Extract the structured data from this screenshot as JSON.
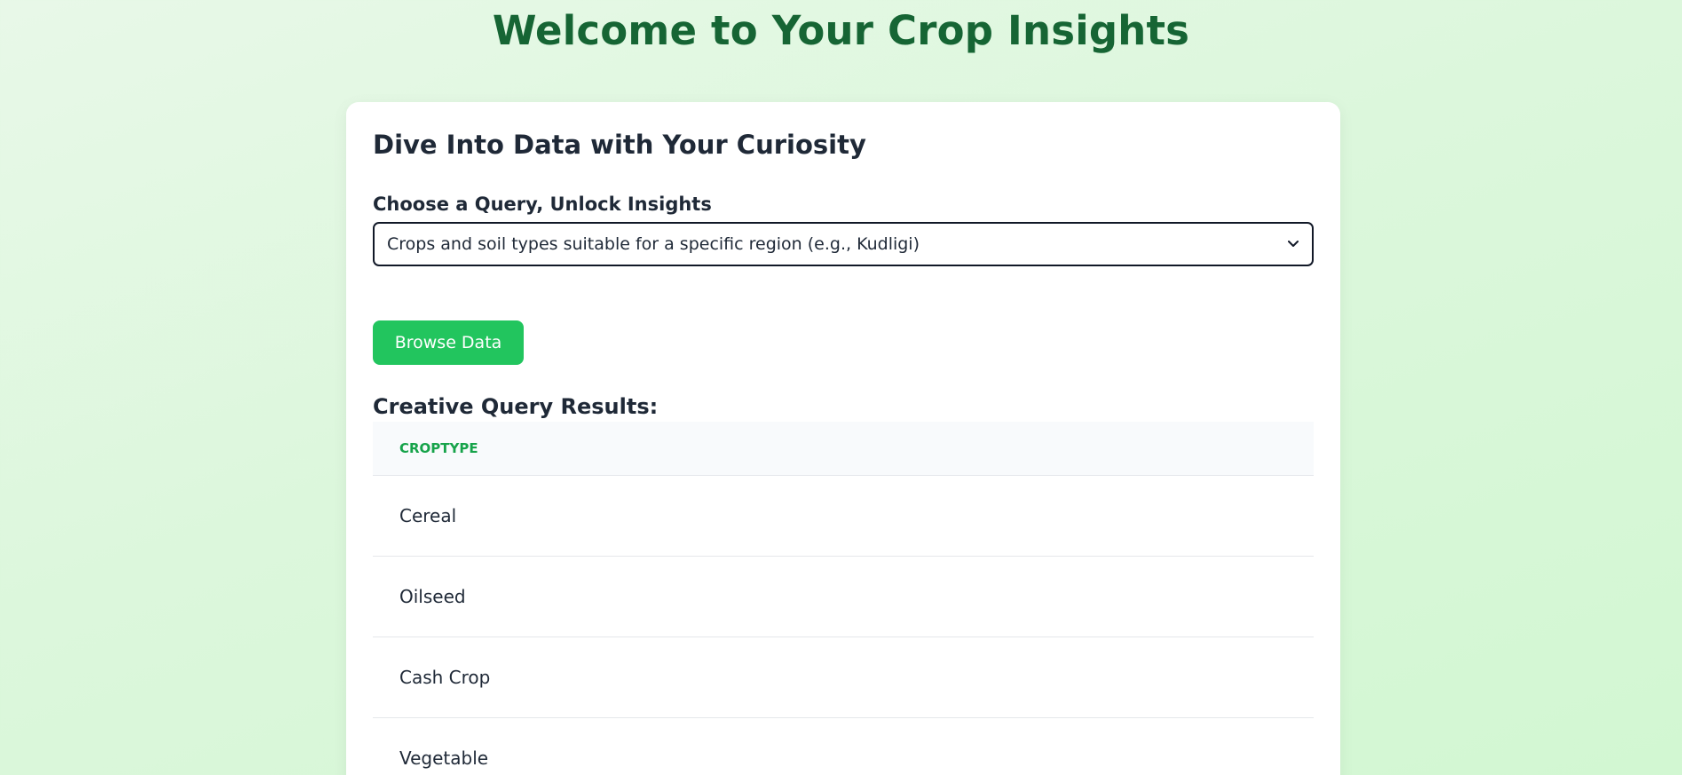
{
  "header": {
    "title": "Welcome to Your Crop Insights"
  },
  "card": {
    "heading": "Dive Into Data with Your Curiosity",
    "select_label": "Choose a Query, Unlock Insights",
    "select_value": "Crops and soil types suitable for a specific region (e.g., Kudligi)",
    "browse_button": "Browse Data",
    "results_heading": "Creative Query Results:"
  },
  "table": {
    "columns": [
      "CROPTYPE"
    ],
    "rows": [
      "Cereal",
      "Oilseed",
      "Cash Crop",
      "Vegetable"
    ]
  },
  "colors": {
    "title": "#166534",
    "button": "#22c55e",
    "column_header": "#16a34a"
  }
}
